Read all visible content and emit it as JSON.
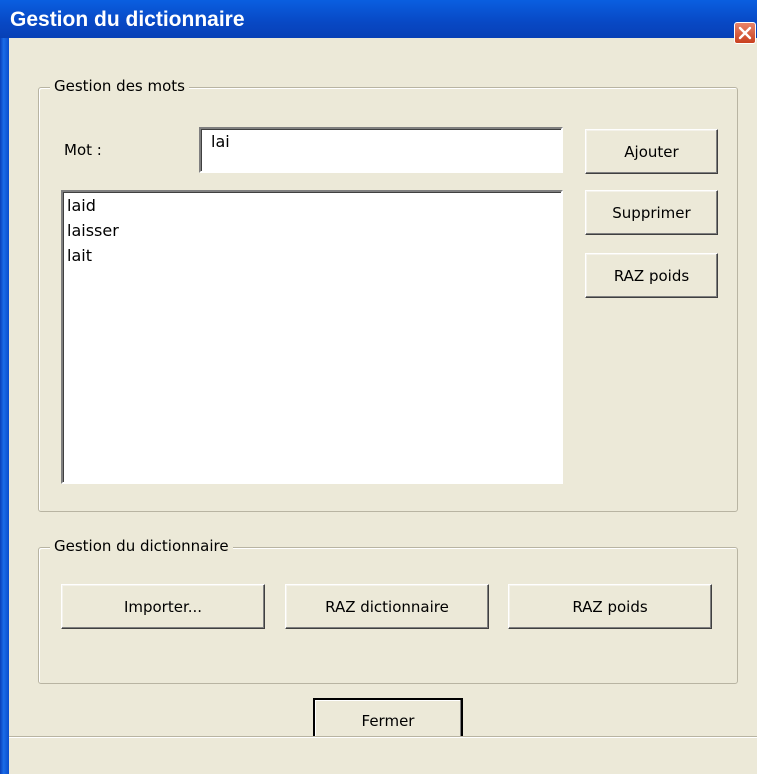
{
  "window": {
    "title": "Gestion du dictionnaire"
  },
  "words_group": {
    "legend": "Gestion des mots",
    "word_label": "Mot :",
    "word_value": "lai",
    "list_items": [
      "laid",
      "laisser",
      "lait"
    ],
    "add_button": "Ajouter",
    "delete_button": "Supprimer",
    "reset_weight_button": "RAZ poids"
  },
  "dictionary_group": {
    "legend": "Gestion du dictionnaire",
    "import_button": "Importer...",
    "reset_dictionary_button": "RAZ dictionnaire",
    "reset_weight_button": "RAZ poids"
  },
  "footer": {
    "close_button": "Fermer"
  },
  "icons": {
    "close": "close-icon"
  },
  "colors": {
    "titlebar": "#0a5fe0",
    "face": "#ece9d8",
    "close_button": "#c9401e"
  }
}
